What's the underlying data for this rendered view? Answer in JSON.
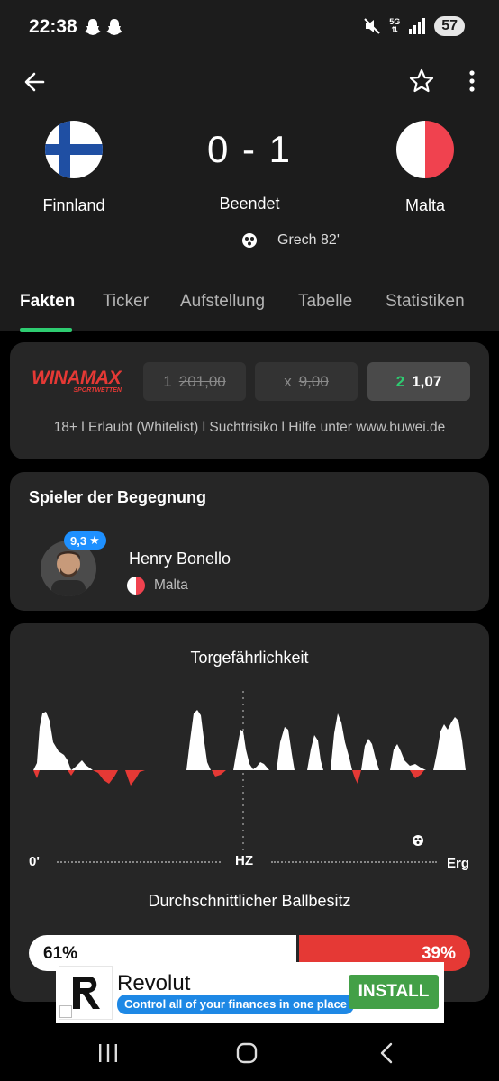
{
  "status_bar": {
    "time": "22:38",
    "battery": "57",
    "network": "5G"
  },
  "match": {
    "home_team": "Finnland",
    "away_team": "Malta",
    "score": "0 - 1",
    "status": "Beendet",
    "goal_event": "Grech 82'"
  },
  "tabs": [
    "Fakten",
    "Ticker",
    "Aufstellung",
    "Tabelle",
    "Statistiken"
  ],
  "odds": {
    "bookmaker": "WINAMAX",
    "bookmaker_sub": "SPORTWETTEN",
    "items": [
      {
        "label": "1",
        "value": "201,00"
      },
      {
        "label": "x",
        "value": "9,00"
      },
      {
        "label": "2",
        "value": "1,07"
      }
    ],
    "disclaimer": "18+ l Erlaubt (Whitelist) l Suchtrisiko l Hilfe unter www.buwei.de"
  },
  "player_of_match": {
    "title": "Spieler der Begegnung",
    "rating": "9,3",
    "name": "Henry Bonello",
    "team": "Malta"
  },
  "momentum": {
    "title": "Torgefährlichkeit",
    "start_label": "0'",
    "half_label": "HZ",
    "end_label": "Erg"
  },
  "possession": {
    "title": "Durchschnittlicher Ballbesitz",
    "home_pct": "61%",
    "away_pct": "39%",
    "home_value": 61,
    "away_value": 39
  },
  "ad": {
    "brand": "Revolut",
    "tagline": "Control all of your finances in one place",
    "cta": "INSTALL"
  },
  "colors": {
    "accent": "#2ecc71",
    "away": "#e53935",
    "card": "#262626",
    "header": "#1c1c1c"
  }
}
